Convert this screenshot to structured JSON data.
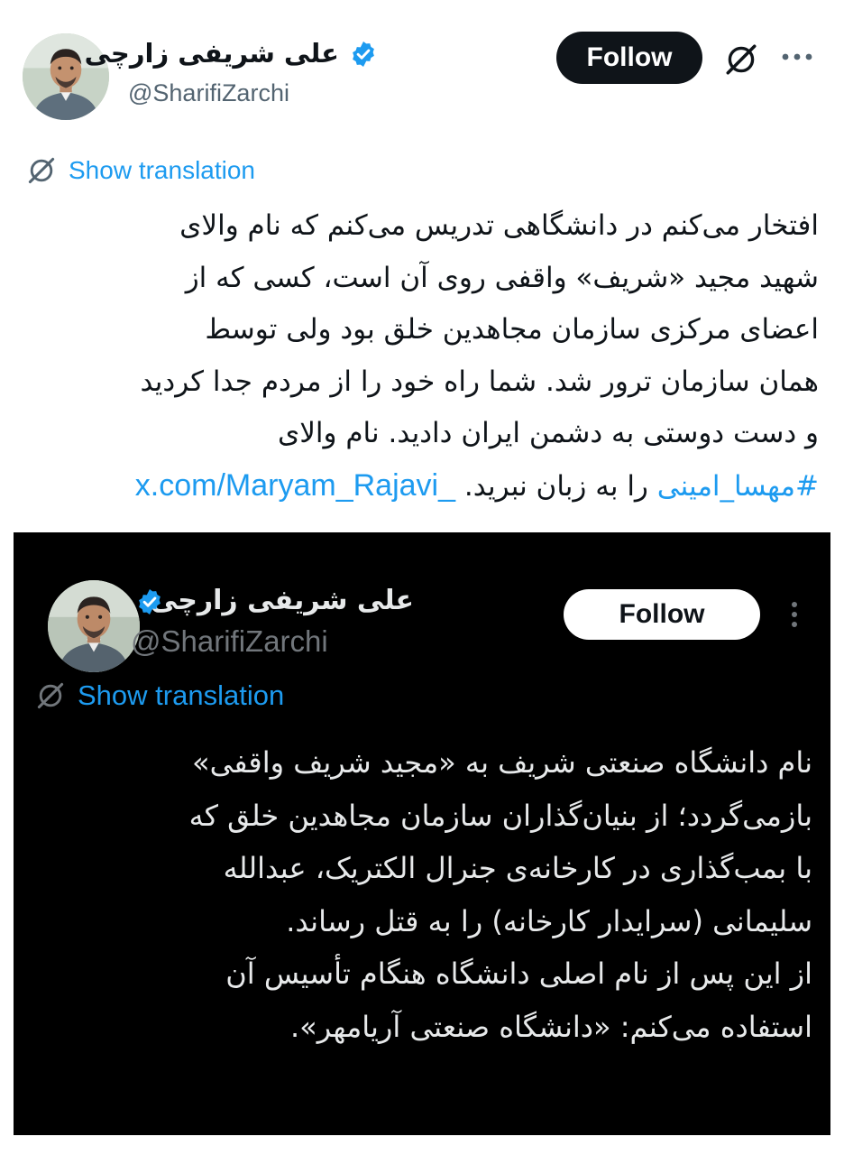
{
  "tweet": {
    "author_name": "علی شریفی زارچی",
    "handle": "@SharifiZarchi",
    "follow_label": "Follow",
    "show_translation": "Show translation",
    "body_lines": [
      "افتخار می‌کنم در دانشگاهی تدریس می‌کنم که نام والای",
      "شهید مجید «شریف» واقفی روی آن است، کسی که از",
      "اعضای مرکزی سازمان مجاهدین خلق بود ولی توسط",
      "همان سازمان ترور شد. شما راه خود را از مردم جدا کردید",
      "و دست دوستی به دشمن ایران دادید. نام والای"
    ],
    "last_line": {
      "hashtag": "#مهسا_امینی",
      "text": " را به زبان نبرید. ",
      "url": "x.com/Maryam_Rajavi_"
    },
    "icons": {
      "verified": "verified-badge-icon",
      "grok": "grok-icon",
      "more": "more-horizontal-icon",
      "translate": "translate-icon"
    },
    "colors": {
      "link": "#1d9bf0",
      "follow_bg": "#0f1419",
      "verified": "#1d9bf0"
    }
  },
  "quoted": {
    "author_name": "علی شریفی زارچی",
    "handle": "@SharifiZarchi",
    "follow_label": "Follow",
    "show_translation": "Show translation",
    "body_lines": [
      "نام دانشگاه صنعتی شریف به «مجید شریف واقفی»",
      "بازمی‌گردد؛ از بنیان‌گذاران سازمان مجاهدین خلق که",
      "با بمب‌گذاری در کارخانه‌ی جنرال الکتریک، عبدالله",
      "سلیمانی (سرایدار کارخانه) را به قتل رساند.",
      "از این پس از نام اصلی دانشگاه هنگام تأسیس آن",
      "استفاده می‌کنم: «دانشگاه صنعتی آریامهر»."
    ],
    "icons": {
      "verified": "verified-badge-icon",
      "more": "more-vertical-icon",
      "translate": "translate-icon"
    },
    "colors": {
      "background": "#000000",
      "text": "#e7e9ea",
      "follow_bg": "#ffffff"
    }
  }
}
